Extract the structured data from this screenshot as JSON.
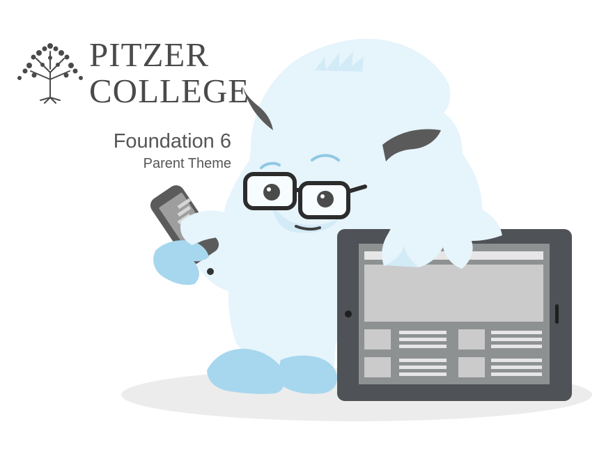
{
  "brand": {
    "line1": "PITZER",
    "line2": "COLLEGE"
  },
  "heading": {
    "title": "Foundation 6",
    "subtitle": "Parent Theme"
  },
  "colors": {
    "yeti_fur": "#e6f4fb",
    "yeti_shade": "#a7d7ee",
    "horn": "#5a5a5a",
    "device_dark": "#4f5256",
    "device_screen": "#8e9192",
    "shadow": "#ececec",
    "brand_text": "#4a4a4a"
  }
}
